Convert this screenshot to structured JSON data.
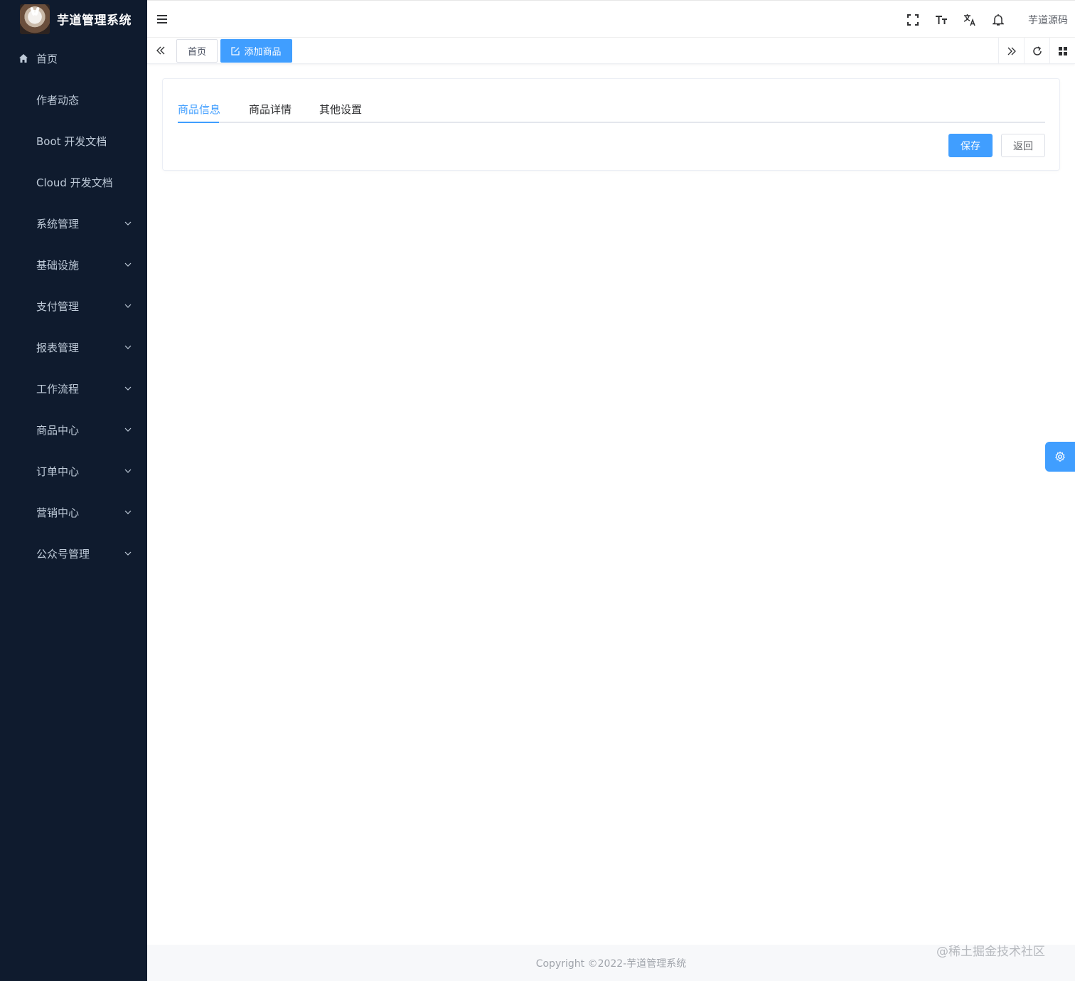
{
  "app": {
    "title": "芋道管理系统"
  },
  "sidebar": {
    "items": [
      {
        "label": "首页",
        "icon": "home-icon",
        "expandable": false
      },
      {
        "label": "作者动态",
        "expandable": false
      },
      {
        "label": "Boot 开发文档",
        "expandable": false
      },
      {
        "label": "Cloud 开发文档",
        "expandable": false
      },
      {
        "label": "系统管理",
        "expandable": true
      },
      {
        "label": "基础设施",
        "expandable": true
      },
      {
        "label": "支付管理",
        "expandable": true
      },
      {
        "label": "报表管理",
        "expandable": true
      },
      {
        "label": "工作流程",
        "expandable": true
      },
      {
        "label": "商品中心",
        "expandable": true
      },
      {
        "label": "订单中心",
        "expandable": true
      },
      {
        "label": "营销中心",
        "expandable": true
      },
      {
        "label": "公众号管理",
        "expandable": true
      }
    ]
  },
  "navbar": {
    "icons": [
      "fullscreen-icon",
      "font-size-icon",
      "translate-icon",
      "bell-icon"
    ],
    "user": "芋道源码"
  },
  "tags": {
    "home": "首页",
    "active": "添加商品"
  },
  "tabs": [
    {
      "label": "商品信息",
      "active": true
    },
    {
      "label": "商品详情",
      "active": false
    },
    {
      "label": "其他设置",
      "active": false
    }
  ],
  "actions": {
    "save": "保存",
    "back": "返回"
  },
  "footer": {
    "copyright": "Copyright ©2022-芋道管理系统"
  },
  "watermark": "@稀土掘金技术社区",
  "colors": {
    "sidebar_bg": "#0f1b2e",
    "primary": "#409eff",
    "sidebar_text": "#bfcbd9"
  }
}
